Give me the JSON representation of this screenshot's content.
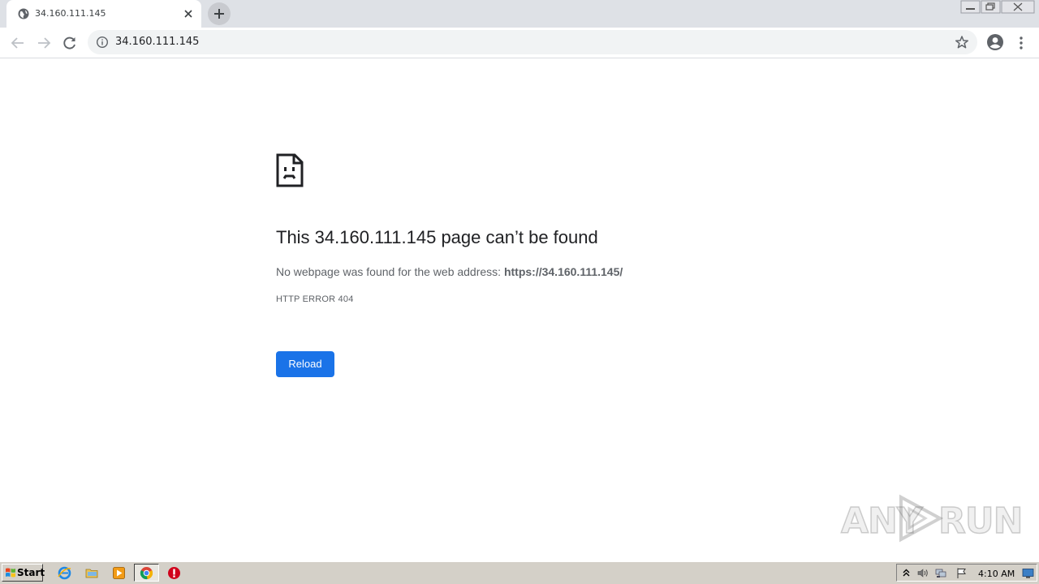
{
  "browser": {
    "tab": {
      "title": "34.160.111.145",
      "favicon": "globe-icon"
    },
    "new_tab_icon": "plus-icon",
    "window_controls": [
      "minimize-icon",
      "restore-icon",
      "close-icon"
    ],
    "toolbar": {
      "back_icon": "arrow-left-icon",
      "forward_icon": "arrow-right-icon",
      "reload_icon": "reload-icon",
      "address": "34.160.111.145",
      "info_icon": "info-icon",
      "bookmark_icon": "star-icon",
      "profile_icon": "account-icon",
      "menu_icon": "kebab-menu-icon"
    }
  },
  "error_page": {
    "icon": "sad-page-icon",
    "title": "This 34.160.111.145 page can’t be found",
    "description_prefix": "No webpage was found for the web address: ",
    "description_url": "https://34.160.111.145/",
    "error_code": "HTTP ERROR 404",
    "reload_label": "Reload",
    "reload_color": "#1a73e8"
  },
  "watermark": {
    "text_left": "ANY",
    "text_right": "RUN"
  },
  "taskbar": {
    "start_label": "Start",
    "pinned": [
      "internet-explorer-icon",
      "folder-icon",
      "media-player-icon",
      "chrome-icon",
      "stop-icon"
    ],
    "tray_icons": [
      "show-hidden-icon",
      "volume-icon",
      "network-icon",
      "action-center-flag-icon",
      "show-desktop-icon"
    ],
    "clock": "4:10 AM"
  }
}
